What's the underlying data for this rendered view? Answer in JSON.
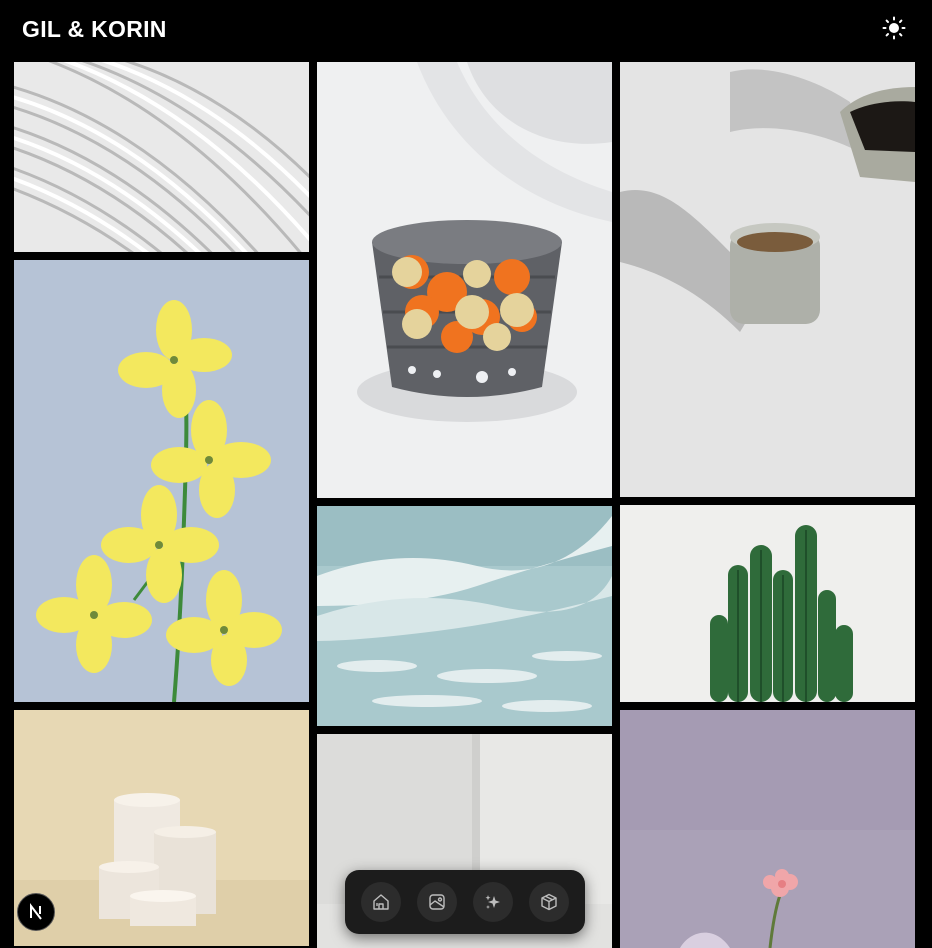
{
  "header": {
    "brand": "GIL & KORIN",
    "theme_toggle_icon": "sun-icon"
  },
  "gallery": {
    "photos": [
      {
        "subject": "white-architecture",
        "column": 1
      },
      {
        "subject": "yellow-flowers",
        "column": 1
      },
      {
        "subject": "white-pedestals",
        "column": 1
      },
      {
        "subject": "orange-basket",
        "column": 2
      },
      {
        "subject": "ocean-waves",
        "column": 2
      },
      {
        "subject": "white-interior",
        "column": 2
      },
      {
        "subject": "coffee-cup",
        "column": 3
      },
      {
        "subject": "cactus",
        "column": 3
      },
      {
        "subject": "pink-flower",
        "column": 3
      }
    ]
  },
  "dock": {
    "items": [
      {
        "icon": "home-icon"
      },
      {
        "icon": "image-icon"
      },
      {
        "icon": "sparkles-icon"
      },
      {
        "icon": "box-icon"
      }
    ]
  },
  "badge": {
    "letter": "N"
  },
  "colors": {
    "background": "#000000",
    "dock": "#1c1c1c",
    "dock_button": "#2c2c2c",
    "icon": "#bdbdbd"
  }
}
